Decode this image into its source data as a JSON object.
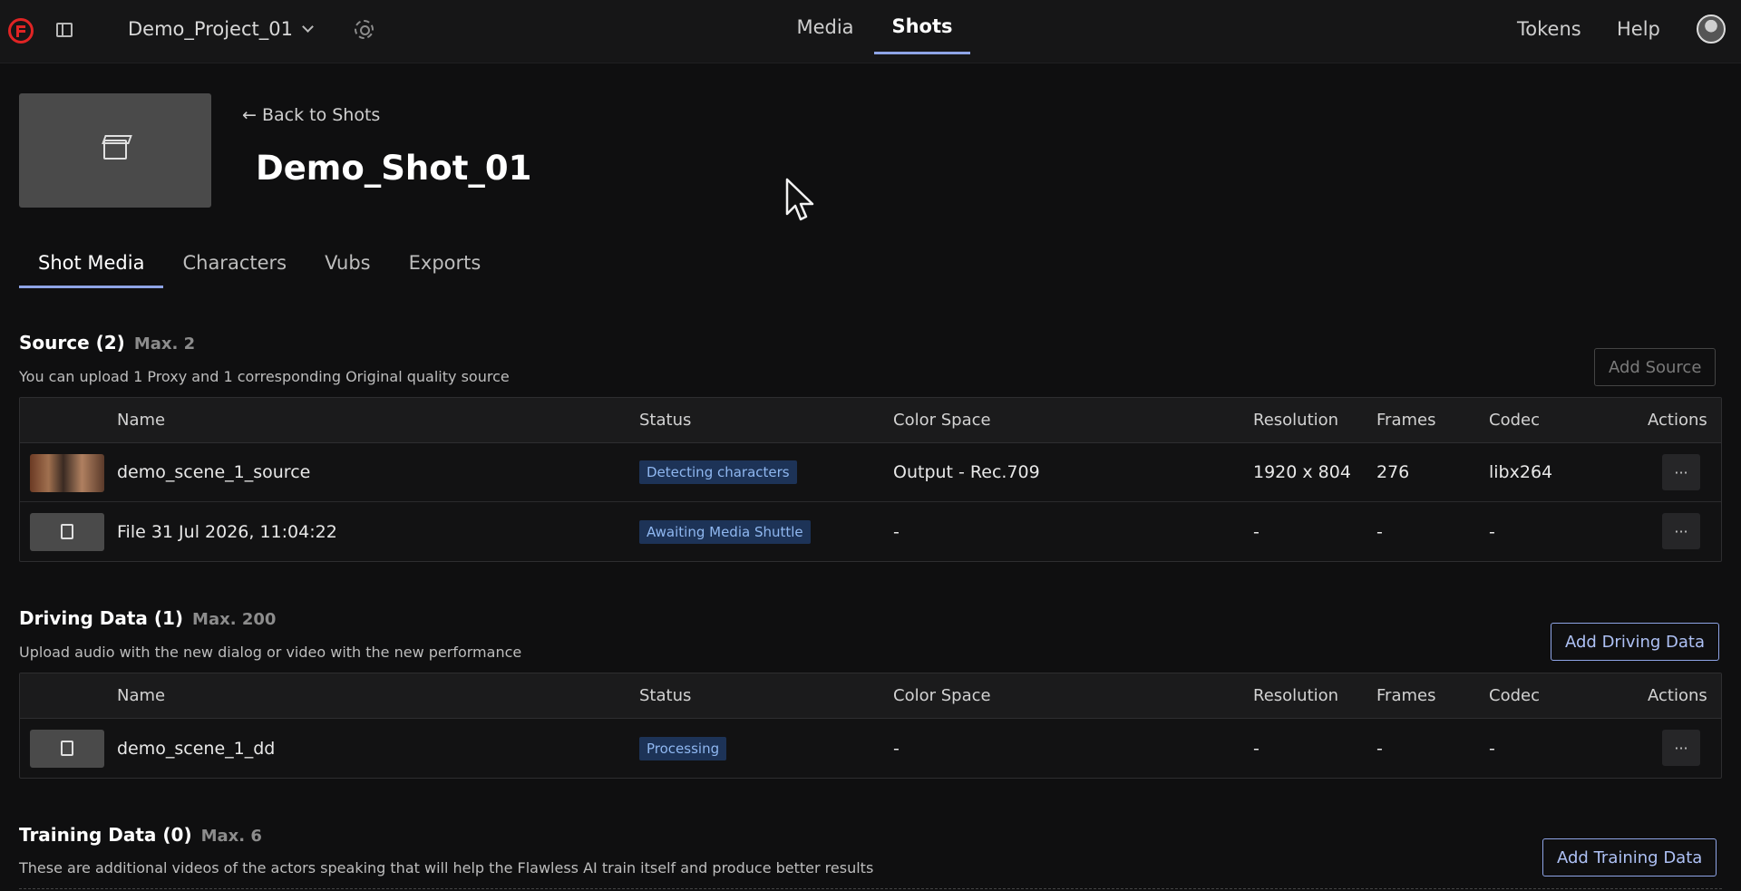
{
  "topbar": {
    "project": "Demo_Project_01",
    "nav": {
      "media": "Media",
      "shots": "Shots"
    },
    "tokens": "Tokens",
    "help": "Help"
  },
  "header": {
    "back": "← Back to Shots",
    "title": "Demo_Shot_01"
  },
  "tabs": [
    "Shot Media",
    "Characters",
    "Vubs",
    "Exports"
  ],
  "columns": [
    "Name",
    "Status",
    "Color Space",
    "Resolution",
    "Frames",
    "Codec",
    "Actions"
  ],
  "source": {
    "title": "Source (2)",
    "max": "Max. 2",
    "desc": "You can upload 1 Proxy and 1 corresponding Original quality source",
    "button": "Add Source",
    "rows": [
      {
        "thumb": "video-thumbnail",
        "name": "demo_scene_1_source",
        "status": "Detecting characters",
        "color_space": "Output - Rec.709",
        "resolution": "1920 x 804",
        "frames": "276",
        "codec": "libx264",
        "actions": "···"
      },
      {
        "thumb": "file-icon",
        "name": "File 31 Jul 2026, 11:04:22",
        "status": "Awaiting Media Shuttle",
        "color_space": "-",
        "resolution": "-",
        "frames": "-",
        "codec": "-",
        "actions": "···"
      }
    ]
  },
  "driving": {
    "title": "Driving Data (1)",
    "max": "Max. 200",
    "desc": "Upload audio with the new dialog or video with the new performance",
    "button": "Add Driving Data",
    "rows": [
      {
        "thumb": "audio-file-icon",
        "name": "demo_scene_1_dd",
        "status": "Processing",
        "color_space": "-",
        "resolution": "-",
        "frames": "-",
        "codec": "-",
        "actions": "···"
      }
    ]
  },
  "training": {
    "title": "Training Data (0)",
    "max": "Max. 6",
    "desc": "These are additional videos of the actors speaking that will help the Flawless AI train itself and produce better results",
    "button": "Add Training Data"
  },
  "colors": {
    "accent": "#8ea4e6",
    "badge_bg": "#1d3357",
    "badge_text": "#8fb7f0",
    "logo": "#e02424"
  }
}
